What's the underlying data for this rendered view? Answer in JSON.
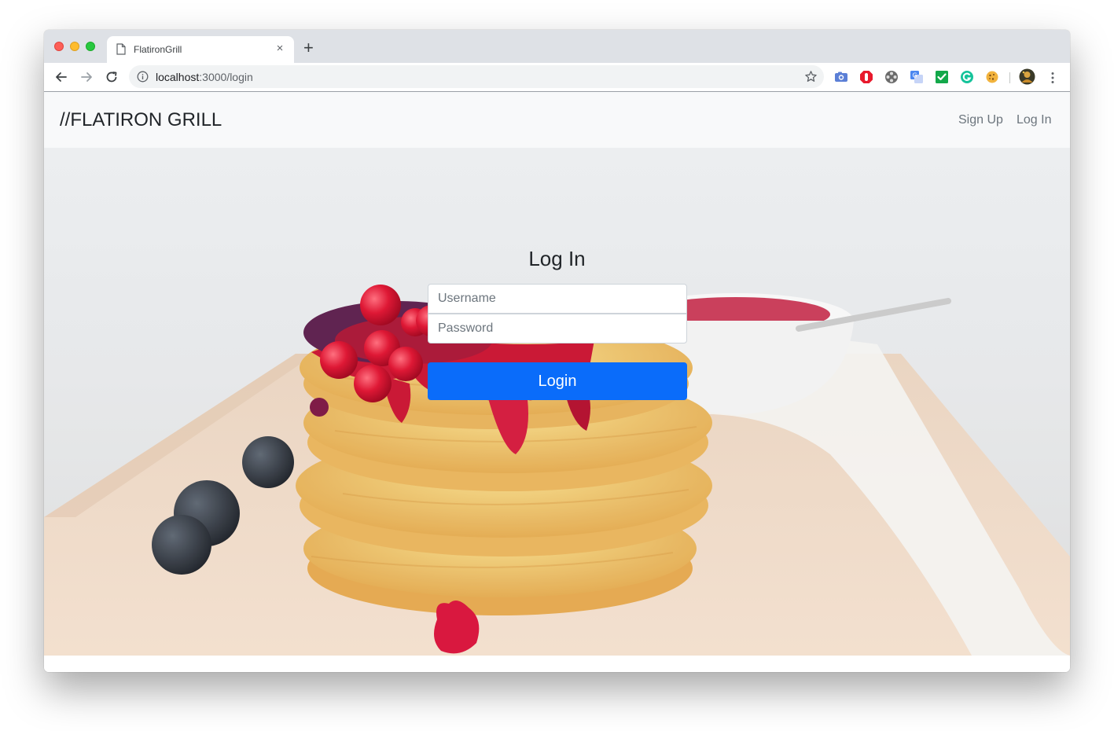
{
  "browser": {
    "tab_title": "FlatironGrill",
    "tab_close": "×",
    "new_tab": "+",
    "url_host": "localhost",
    "url_path": ":3000/login",
    "extensions": [
      "camera-extension-icon",
      "adblock-extension-icon",
      "film-extension-icon",
      "translate-extension-icon",
      "checkmark-extension-icon",
      "grammarly-extension-icon",
      "cookie-extension-icon",
      "profile-avatar"
    ]
  },
  "navbar": {
    "brand": "//FLATIRON GRILL",
    "links": [
      "Sign Up",
      "Log In"
    ]
  },
  "login": {
    "title": "Log In",
    "username_placeholder": "Username",
    "password_placeholder": "Password",
    "submit_label": "Login"
  },
  "colors": {
    "primary_button": "#0a6cfa",
    "navbar_bg": "#f8f9fa"
  }
}
